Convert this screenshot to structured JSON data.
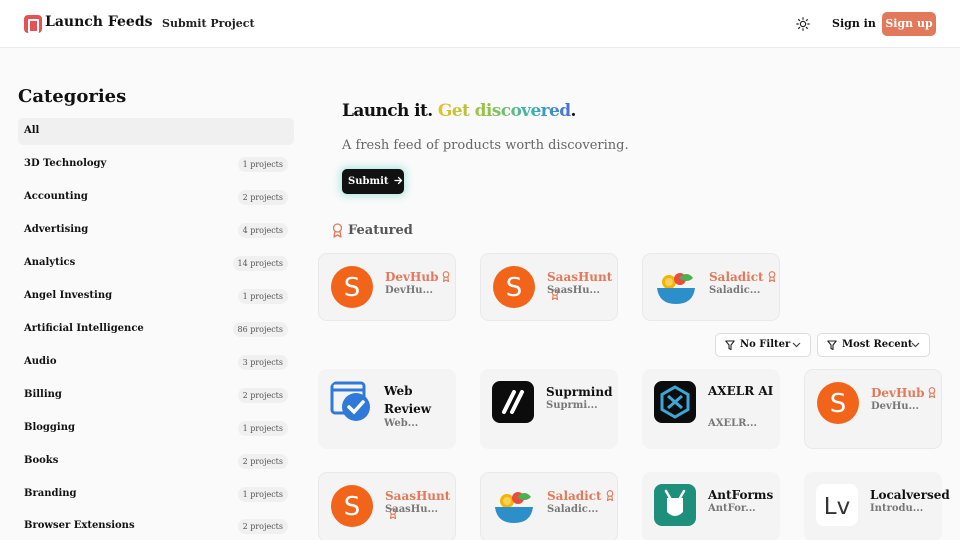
{
  "header": {
    "brand": "Launch Feeds",
    "nav_submit": "Submit Project",
    "theme_icon": "sun-icon",
    "sign_in": "Sign in",
    "sign_up": "Sign up"
  },
  "colors": {
    "accent": "#e2795a",
    "logo": "#e45353",
    "dark_button": "#111111"
  },
  "sidebar": {
    "title": "Categories",
    "items": [
      {
        "label": "All",
        "count": ""
      },
      {
        "label": "3D Technology",
        "count": "1 projects"
      },
      {
        "label": "Accounting",
        "count": "2 projects"
      },
      {
        "label": "Advertising",
        "count": "4 projects"
      },
      {
        "label": "Analytics",
        "count": "14 projects"
      },
      {
        "label": "Angel Investing",
        "count": "1 projects"
      },
      {
        "label": "Artificial Intelligence",
        "count": "86 projects"
      },
      {
        "label": "Audio",
        "count": "3 projects"
      },
      {
        "label": "Billing",
        "count": "2 projects"
      },
      {
        "label": "Blogging",
        "count": "1 projects"
      },
      {
        "label": "Books",
        "count": "2 projects"
      },
      {
        "label": "Branding",
        "count": "1 projects"
      },
      {
        "label": "Browser Extensions",
        "count": "2 projects"
      }
    ]
  },
  "hero": {
    "headline_a": "Launch it. ",
    "headline_b": "Get discovered",
    "headline_c": ".",
    "subtitle": "A fresh feed of products worth discovering.",
    "submit_label": "Submit"
  },
  "featured": {
    "label": "Featured",
    "cards": [
      {
        "title": "DevHub",
        "sub": "DevHu...",
        "icon": "devhub-logo-icon"
      },
      {
        "title": "SaasHunt",
        "sub": "SaasHu...",
        "icon": "saashunt-logo-icon"
      },
      {
        "title": "Saladict",
        "sub": "Saladic...",
        "icon": "saladict-logo-icon"
      }
    ]
  },
  "filters": {
    "filter_label": "No Filter",
    "sort_label": "Most Recent"
  },
  "grid": {
    "row1": [
      {
        "title": "Web Review",
        "sub": "Web...",
        "icon": "web-review-logo-icon"
      },
      {
        "title": "Suprmind",
        "sub": "Suprmi...",
        "icon": "suprmind-logo-icon"
      },
      {
        "title": "AXELR AI",
        "sub": "AXELR...",
        "icon": "axelr-logo-icon"
      },
      {
        "title": "DevHub",
        "sub": "DevHu...",
        "icon": "devhub-logo-icon"
      }
    ],
    "row2": [
      {
        "title": "SaasHunt",
        "sub": "SaasHu...",
        "icon": "saashunt-logo-icon"
      },
      {
        "title": "Saladict",
        "sub": "Saladic...",
        "icon": "saladict-logo-icon"
      },
      {
        "title": "AntForms",
        "sub": "AntFor...",
        "icon": "antforms-logo-icon"
      },
      {
        "title": "Localversed",
        "sub": "Introdu...",
        "icon": "localversed-logo-icon"
      }
    ]
  }
}
